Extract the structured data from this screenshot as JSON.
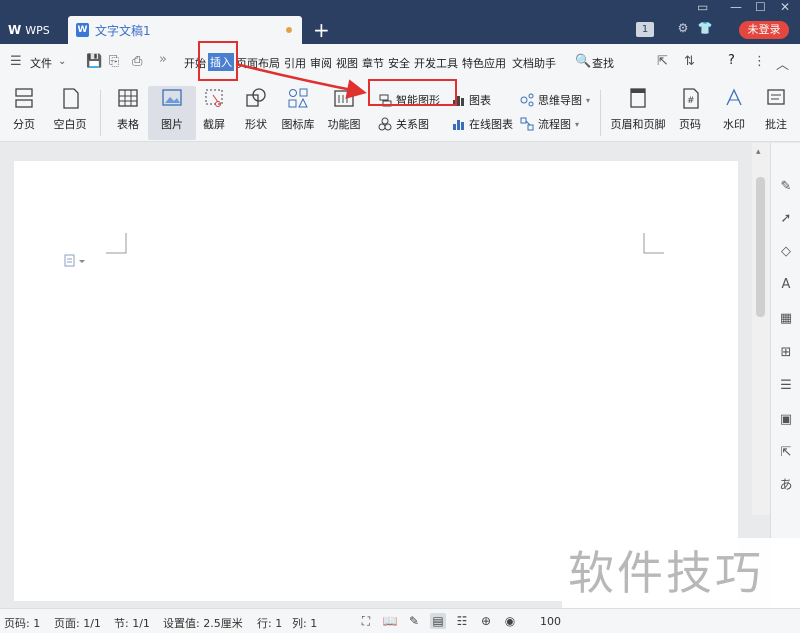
{
  "titlebar": {
    "app_tab": "WPS",
    "doc_tab": "文字文稿1",
    "new_tab": "+",
    "badge": "1",
    "login": "未登录"
  },
  "menu": {
    "file": "文件",
    "more": "»",
    "items": [
      "开始",
      "插入",
      "页面布局",
      "引用",
      "审阅",
      "视图",
      "章节",
      "安全",
      "开发工具",
      "特色应用",
      "文档助手"
    ],
    "search": "查找",
    "help": "?"
  },
  "ribbon": {
    "paging": "分页",
    "blank_page": "空白页",
    "table": "表格",
    "picture": "图片",
    "screenshot": "截屏",
    "shape": "形状",
    "icon_lib": "图标库",
    "func_chart": "功能图",
    "smart_art": "智能图形",
    "relation": "关系图",
    "chart": "图表",
    "online_chart": "在线图表",
    "mind_map": "思维导图",
    "flowchart": "流程图",
    "header_footer": "页眉和页脚",
    "page_num": "页码",
    "watermark": "水印",
    "comment": "批注"
  },
  "status": {
    "page_code": "页码: 1",
    "page": "页面: 1/1",
    "section": "节: 1/1",
    "setting": "设置值: 2.5厘米",
    "row": "行: 1",
    "col": "列: 1",
    "zoom": "100"
  },
  "watermark_text": "软件技巧",
  "colors": {
    "titlebar": "#2b3f62",
    "accent": "#4a7fd0",
    "annotation": "#e03131",
    "login": "#e4473f"
  }
}
